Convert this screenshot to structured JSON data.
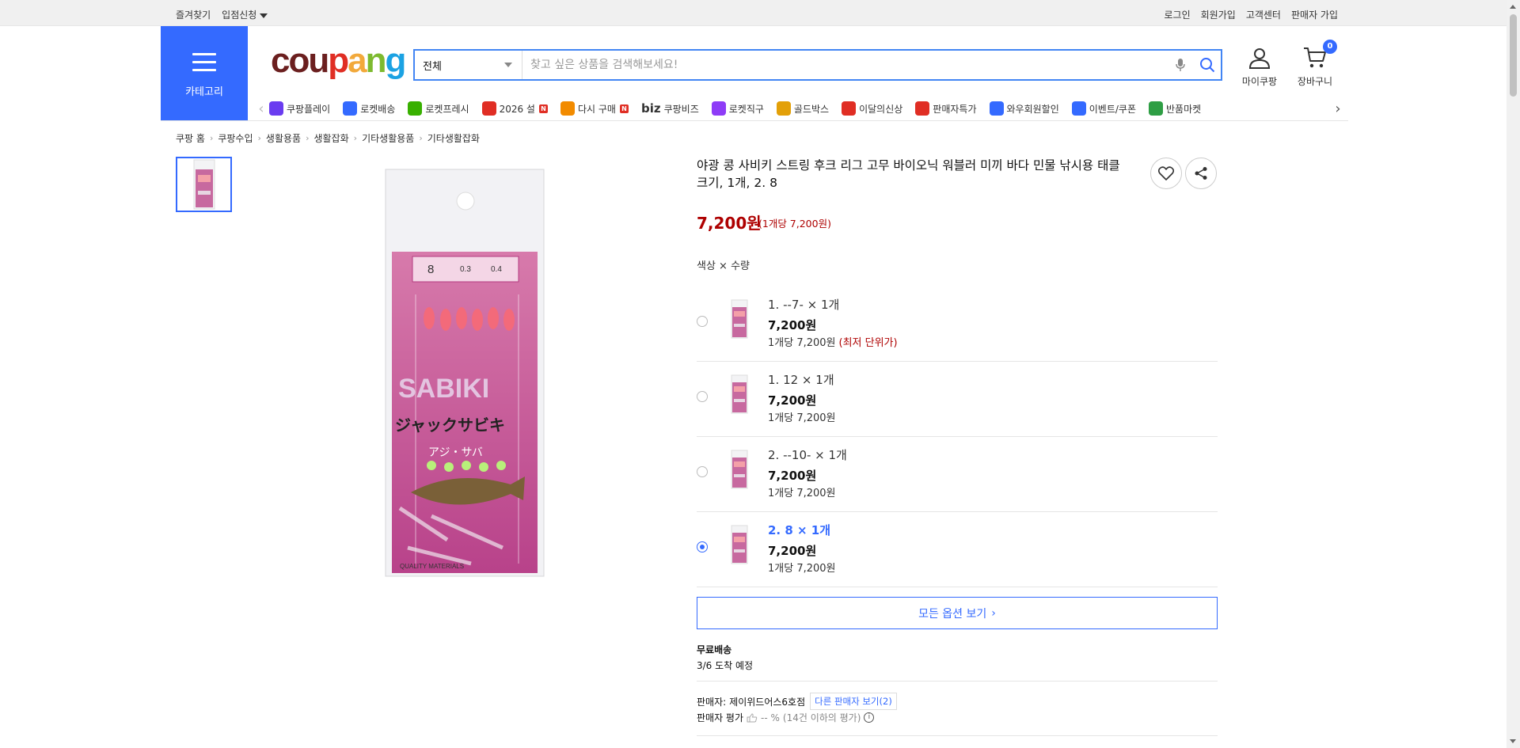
{
  "topbar": {
    "left": [
      "즐겨찾기",
      "입점신청"
    ],
    "right": [
      "로그인",
      "회원가입",
      "고객센터",
      "판매자 가입"
    ]
  },
  "header": {
    "category_label": "카테고리",
    "logo": [
      "cou",
      "p",
      "a",
      "n",
      "g"
    ],
    "search": {
      "scope": "전체",
      "placeholder": "찾고 싶은 상품을 검색해보세요!"
    },
    "mycoupang_label": "마이쿠팡",
    "cart_label": "장바구니",
    "cart_count": "0"
  },
  "quick_nav": [
    {
      "label": "쿠팡플레이",
      "icon": "play-icon",
      "color": "#6a3cf0"
    },
    {
      "label": "로켓배송",
      "icon": "rocket-icon",
      "color": "#346aff"
    },
    {
      "label": "로켓프레시",
      "icon": "rocket-fresh-icon",
      "color": "#38b000"
    },
    {
      "label": "2026 설",
      "icon": "gift-icon",
      "color": "#e02e24",
      "badge": "N"
    },
    {
      "label": "다시 구매",
      "icon": "house-icon",
      "color": "#f28b00",
      "badge": "N"
    },
    {
      "label": "쿠팡비즈",
      "icon": "biz-icon",
      "color": "#333333",
      "prefix": "biz"
    },
    {
      "label": "로켓직구",
      "icon": "global-rocket-icon",
      "color": "#8e3cf7"
    },
    {
      "label": "골드박스",
      "icon": "goldbox-icon",
      "color": "#e3a008"
    },
    {
      "label": "이달의신상",
      "icon": "new-bag-icon",
      "color": "#e02e24"
    },
    {
      "label": "판매자특가",
      "icon": "percent-icon",
      "color": "#e02e24"
    },
    {
      "label": "와우회원할인",
      "icon": "wow-icon",
      "color": "#346aff"
    },
    {
      "label": "이벤트/쿠폰",
      "icon": "coupon-icon",
      "color": "#346aff"
    },
    {
      "label": "반품마켓",
      "icon": "return-market-icon",
      "color": "#2e9e44"
    }
  ],
  "breadcrumb": [
    "쿠팡 홈",
    "쿠팡수입",
    "생활용품",
    "생활잡화",
    "기타생활용품",
    "기타생활잡화"
  ],
  "product": {
    "title": "야광 콩 사비키 스트링 후크 리그 고무 바이오닉 워블러 미끼 바다 민물 낚시용 태클 크기, 1개, 2. 8",
    "price": "7,200원",
    "unit_price": "(1개당 7,200원)",
    "option_label": "색상 × 수량",
    "options": [
      {
        "name": "1. --7- × 1개",
        "price": "7,200원",
        "unit": "1개당 7,200원",
        "note": "(최저 단위가)",
        "selected": false
      },
      {
        "name": "1. 12 × 1개",
        "price": "7,200원",
        "unit": "1개당 7,200원",
        "note": "",
        "selected": false
      },
      {
        "name": "2. --10- × 1개",
        "price": "7,200원",
        "unit": "1개당 7,200원",
        "note": "",
        "selected": false
      },
      {
        "name": "2. 8 × 1개",
        "price": "7,200원",
        "unit": "1개당 7,200원",
        "note": "",
        "selected": true
      }
    ],
    "all_options": "모든 옵션 보기",
    "shipping_title": "무료배송",
    "shipping_eta": "3/6 도착 예정",
    "seller_label": "판매자:",
    "seller_name": "제이위드어스6호점",
    "other_sellers": "다른 판매자 보기(2)",
    "seller_rating_label": "판매자 평가",
    "seller_rating_value": "-- %",
    "seller_rating_note": "(14건 이하의 평가)"
  },
  "image_text": {
    "specs": [
      "8",
      "0.3",
      "0.4"
    ],
    "brand": "SABIKI",
    "jp": "ジャックサビキ",
    "jp2": "アジ・サバ",
    "quality": "QUALITY MATERIALS"
  }
}
